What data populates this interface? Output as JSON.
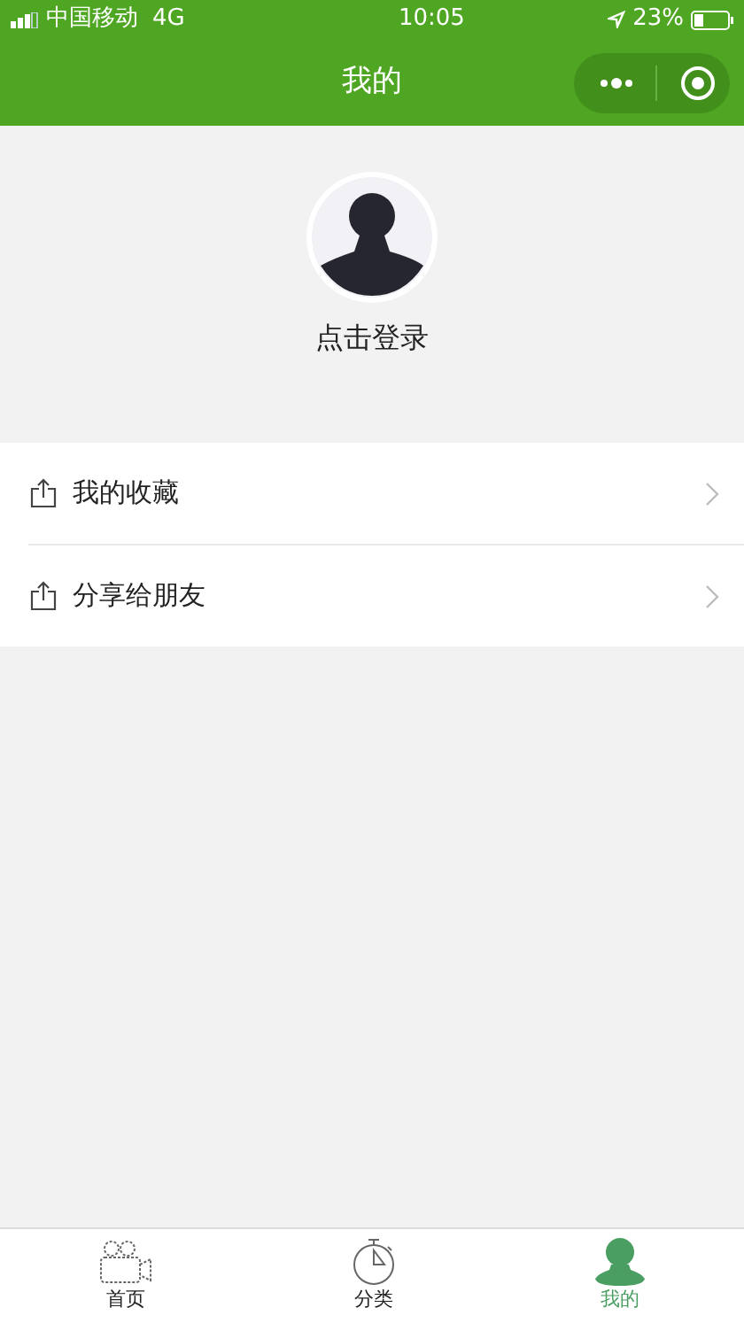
{
  "status_bar": {
    "carrier": "中国移动",
    "network": "4G",
    "time": "10:05",
    "battery": "23%"
  },
  "nav_bar": {
    "title": "我的"
  },
  "profile": {
    "login_text": "点击登录"
  },
  "menu": [
    {
      "label": "我的收藏"
    },
    {
      "label": "分享给朋友"
    }
  ],
  "tab_bar": [
    {
      "label": "首页",
      "selected": false
    },
    {
      "label": "分类",
      "selected": false
    },
    {
      "label": "我的",
      "selected": true
    }
  ]
}
